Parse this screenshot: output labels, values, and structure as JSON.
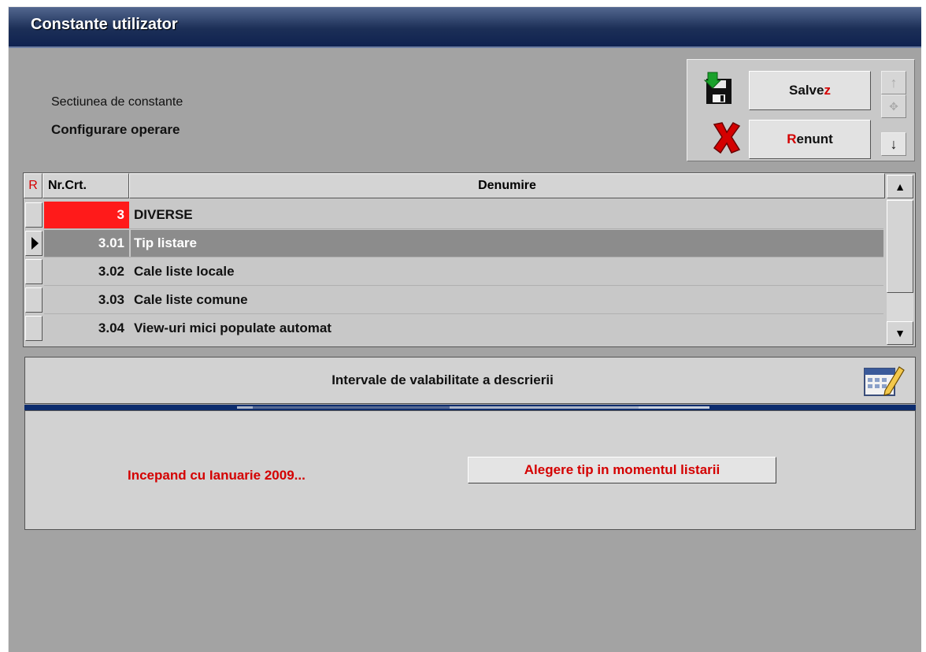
{
  "window": {
    "title": "Constante utilizator"
  },
  "section": {
    "label": "Sectiunea de constante",
    "value": "Configurare operare"
  },
  "toolbar": {
    "save_label": "Salvez",
    "save_main": "Salve",
    "save_accel": "z",
    "cancel_label": "Renunt",
    "cancel_accel": "R",
    "cancel_rest": "enunt"
  },
  "grid": {
    "columns": {
      "r": "R",
      "nr": "Nr.Crt.",
      "denumire": "Denumire"
    },
    "rows": [
      {
        "nr": "3",
        "denumire": "DIVERSE"
      },
      {
        "nr": "3.01",
        "denumire": "Tip listare"
      },
      {
        "nr": "3.02",
        "denumire": "Cale liste locale"
      },
      {
        "nr": "3.03",
        "denumire": "Cale liste comune"
      },
      {
        "nr": "3.04",
        "denumire": "View-uri mici populate automat"
      }
    ],
    "selected_index": 1
  },
  "intervals": {
    "title": "Intervale de valabilitate a descrierii"
  },
  "detail": {
    "start_text": "Incepand cu Ianuarie 2009...",
    "choice_button": "Alegere tip in momentul listarii"
  },
  "colors": {
    "accent_red": "#d40000",
    "title_bar": "#1c2f57",
    "selected_row": "#8c8c8c"
  },
  "icons": [
    "save-disk-icon",
    "cancel-x-icon",
    "arrow-up-icon",
    "move-icon",
    "arrow-down-icon",
    "calendar-edit-icon",
    "row-pointer-icon"
  ]
}
